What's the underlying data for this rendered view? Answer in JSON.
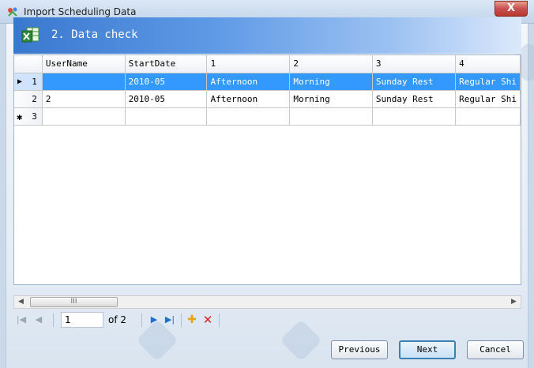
{
  "window": {
    "title": "Import Scheduling Data",
    "close_label": "X"
  },
  "step": {
    "title": "2. Data check",
    "icon": "excel-sheet-icon"
  },
  "grid": {
    "columns": [
      "UserName",
      "StartDate",
      "1",
      "2",
      "3",
      "4"
    ],
    "rows": [
      {
        "num": "1",
        "cells": [
          "",
          "2010-05",
          "Afternoon",
          "Morning",
          "Sunday Rest",
          "Regular Shi"
        ],
        "selected": true,
        "marker": "▶"
      },
      {
        "num": "2",
        "cells": [
          "2",
          "2010-05",
          "Afternoon",
          "Morning",
          "Sunday Rest",
          "Regular Shi"
        ],
        "selected": false,
        "marker": ""
      },
      {
        "num": "3",
        "cells": [
          "",
          "",
          "",
          "",
          "",
          ""
        ],
        "selected": false,
        "marker": "✱"
      }
    ]
  },
  "scrollbar": {
    "left_arrow": "◀",
    "right_arrow": "▶",
    "thumb_grip": "III"
  },
  "navigator": {
    "first": "|◀",
    "prev": "◀",
    "position": "1",
    "of_text": "of 2",
    "next": "▶",
    "last": "▶|",
    "add": "✚",
    "delete": "✕"
  },
  "buttons": {
    "previous": "Previous",
    "next": "Next",
    "cancel": "Cancel"
  },
  "colors": {
    "selection": "#3399ff",
    "header_band": "#3a78cf",
    "add": "#e8a317",
    "delete": "#e02020"
  }
}
